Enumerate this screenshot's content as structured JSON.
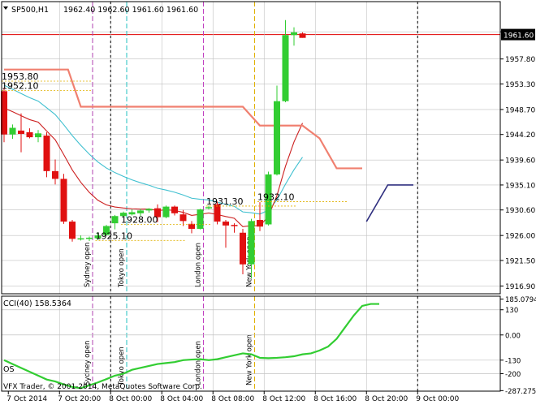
{
  "symbol_label": "SP500,H1",
  "ohlc_label": "1962.40 1962.60 1961.60 1961.60",
  "current_price": "1961.60",
  "colors": {
    "bull": "#32cd32",
    "bear": "#e01010",
    "grid": "#c0c0c0",
    "ma_fast": "#cc2020",
    "ma_medium": "#40c0d0",
    "trail": "#f08070",
    "channel": "#303080",
    "cci": "#32cd32",
    "bid": "#e00000",
    "sydney": "#b040b0",
    "tokyo": "#20c0c0",
    "london": "#c040c0",
    "newyork": "#e0b000"
  },
  "chart_data": [
    {
      "type": "candlestick",
      "ylim": [
        1915.5,
        1965.5
      ],
      "y_ticks": [
        "1961.60",
        "1957.80",
        "1953.30",
        "1948.70",
        "1944.20",
        "1939.60",
        "1935.10",
        "1930.60",
        "1926.00",
        "1921.50",
        "1916.90"
      ],
      "y_tick_values": [
        1962.7,
        1957.8,
        1953.3,
        1948.7,
        1944.2,
        1939.6,
        1935.1,
        1930.6,
        1926.0,
        1921.5,
        1916.9
      ],
      "x_ticks": [
        "7 Oct 2014",
        "7 Oct 20:00",
        "8 Oct 00:00",
        "8 Oct 04:00",
        "8 Oct 08:00",
        "8 Oct 12:00",
        "8 Oct 16:00",
        "8 Oct 20:00",
        "9 Oct 00:00"
      ],
      "x_tick_index": [
        0.5,
        6.5,
        12.5,
        18.5,
        24.5,
        30.5,
        36.5,
        42.5,
        48.5
      ],
      "candles": [
        {
          "o": 1952.0,
          "h": 1952.6,
          "l": 1942.8,
          "c": 1944.2
        },
        {
          "o": 1944.2,
          "h": 1946.0,
          "l": 1943.4,
          "c": 1945.4
        },
        {
          "o": 1944.9,
          "h": 1948.0,
          "l": 1941.0,
          "c": 1944.3
        },
        {
          "o": 1944.6,
          "h": 1945.3,
          "l": 1943.5,
          "c": 1943.7
        },
        {
          "o": 1943.7,
          "h": 1945.0,
          "l": 1942.8,
          "c": 1944.4
        },
        {
          "o": 1944.0,
          "h": 1944.6,
          "l": 1936.5,
          "c": 1937.6
        },
        {
          "o": 1937.6,
          "h": 1939.7,
          "l": 1935.2,
          "c": 1936.2
        },
        {
          "o": 1936.2,
          "h": 1937.1,
          "l": 1928.1,
          "c": 1928.5
        },
        {
          "o": 1928.5,
          "h": 1928.8,
          "l": 1924.9,
          "c": 1925.4
        },
        {
          "o": 1925.4,
          "h": 1926.0,
          "l": 1925.1,
          "c": 1925.5
        },
        {
          "o": 1925.5,
          "h": 1925.8,
          "l": 1925.0,
          "c": 1925.6
        },
        {
          "o": 1925.5,
          "h": 1926.6,
          "l": 1925.2,
          "c": 1926.0
        },
        {
          "o": 1926.1,
          "h": 1927.9,
          "l": 1926.0,
          "c": 1927.7
        },
        {
          "o": 1928.2,
          "h": 1929.7,
          "l": 1927.1,
          "c": 1929.5
        },
        {
          "o": 1929.5,
          "h": 1930.3,
          "l": 1929.3,
          "c": 1930.1
        },
        {
          "o": 1929.8,
          "h": 1930.7,
          "l": 1929.6,
          "c": 1930.2
        },
        {
          "o": 1930.0,
          "h": 1930.8,
          "l": 1929.5,
          "c": 1930.5
        },
        {
          "o": 1930.5,
          "h": 1930.9,
          "l": 1930.1,
          "c": 1930.8
        },
        {
          "o": 1930.9,
          "h": 1931.6,
          "l": 1928.4,
          "c": 1929.3
        },
        {
          "o": 1929.3,
          "h": 1931.4,
          "l": 1929.1,
          "c": 1931.2
        },
        {
          "o": 1931.2,
          "h": 1931.4,
          "l": 1929.6,
          "c": 1930.0
        },
        {
          "o": 1929.8,
          "h": 1930.6,
          "l": 1927.7,
          "c": 1928.6
        },
        {
          "o": 1928.1,
          "h": 1928.6,
          "l": 1926.4,
          "c": 1927.2
        },
        {
          "o": 1927.2,
          "h": 1930.8,
          "l": 1927.1,
          "c": 1930.7
        },
        {
          "o": 1930.9,
          "h": 1931.4,
          "l": 1930.7,
          "c": 1931.1
        },
        {
          "o": 1931.6,
          "h": 1932.1,
          "l": 1928.0,
          "c": 1928.5
        },
        {
          "o": 1928.5,
          "h": 1928.8,
          "l": 1923.8,
          "c": 1927.8
        },
        {
          "o": 1927.9,
          "h": 1928.2,
          "l": 1926.5,
          "c": 1927.7
        },
        {
          "o": 1926.5,
          "h": 1927.2,
          "l": 1919.0,
          "c": 1920.8
        },
        {
          "o": 1920.8,
          "h": 1929.0,
          "l": 1918.3,
          "c": 1928.6
        },
        {
          "o": 1928.8,
          "h": 1932.0,
          "l": 1926.8,
          "c": 1927.6
        },
        {
          "o": 1928.0,
          "h": 1937.5,
          "l": 1927.8,
          "c": 1937.0
        },
        {
          "o": 1937.0,
          "h": 1953.0,
          "l": 1936.8,
          "c": 1950.2
        },
        {
          "o": 1950.2,
          "h": 1964.8,
          "l": 1950.0,
          "c": 1962.1
        },
        {
          "o": 1962.1,
          "h": 1963.5,
          "l": 1960.2,
          "c": 1962.6
        },
        {
          "o": 1962.4,
          "h": 1962.6,
          "l": 1961.6,
          "c": 1961.6
        }
      ],
      "price_labels": [
        {
          "text": "1953.80",
          "value": 1953.8,
          "at": 0
        },
        {
          "text": "1952.10",
          "value": 1952.1,
          "at": 0
        },
        {
          "text": "1925.10",
          "value": 1925.1,
          "at": 11
        },
        {
          "text": "1928.00",
          "value": 1928.0,
          "at": 14
        },
        {
          "text": "1931.30",
          "value": 1931.3,
          "at": 24
        },
        {
          "text": "1932.10",
          "value": 1932.1,
          "at": 30
        }
      ],
      "sessions": [
        {
          "label": "Sydney open",
          "index": 10,
          "color": "#b040b0"
        },
        {
          "label": "Tokyo open",
          "index": 14,
          "color": "#20c0c0"
        },
        {
          "label": "London open",
          "index": 23,
          "color": "#c040c0"
        },
        {
          "label": "New York open",
          "index": 29,
          "color": "#e0b000"
        }
      ]
    },
    {
      "type": "line",
      "title": "CCI(40) 158.5364",
      "ylim": [
        -290,
        200
      ],
      "y_ticks": [
        "185.0794",
        "130",
        "0.00",
        "-130",
        "-200",
        "-287.2753"
      ],
      "y_tick_values": [
        185.0794,
        130,
        0,
        -130,
        -200,
        -287.2753
      ],
      "values": [
        -130,
        -150,
        -170,
        -190,
        -210,
        -230,
        -240,
        -255,
        -268,
        -275,
        -260,
        -245,
        -228,
        -210,
        -200,
        -180,
        -170,
        -160,
        -150,
        -145,
        -140,
        -130,
        -127,
        -125,
        -130,
        -125,
        -115,
        -105,
        -95,
        -100,
        -118,
        -120,
        -118,
        -115,
        -110,
        -100,
        -95,
        -80,
        -60,
        -20,
        40,
        100,
        150,
        160,
        160
      ]
    }
  ],
  "footer_label": "VFX Trader, © 2001-2014, MetaQuotes Software Corp.",
  "os_label": "OS"
}
